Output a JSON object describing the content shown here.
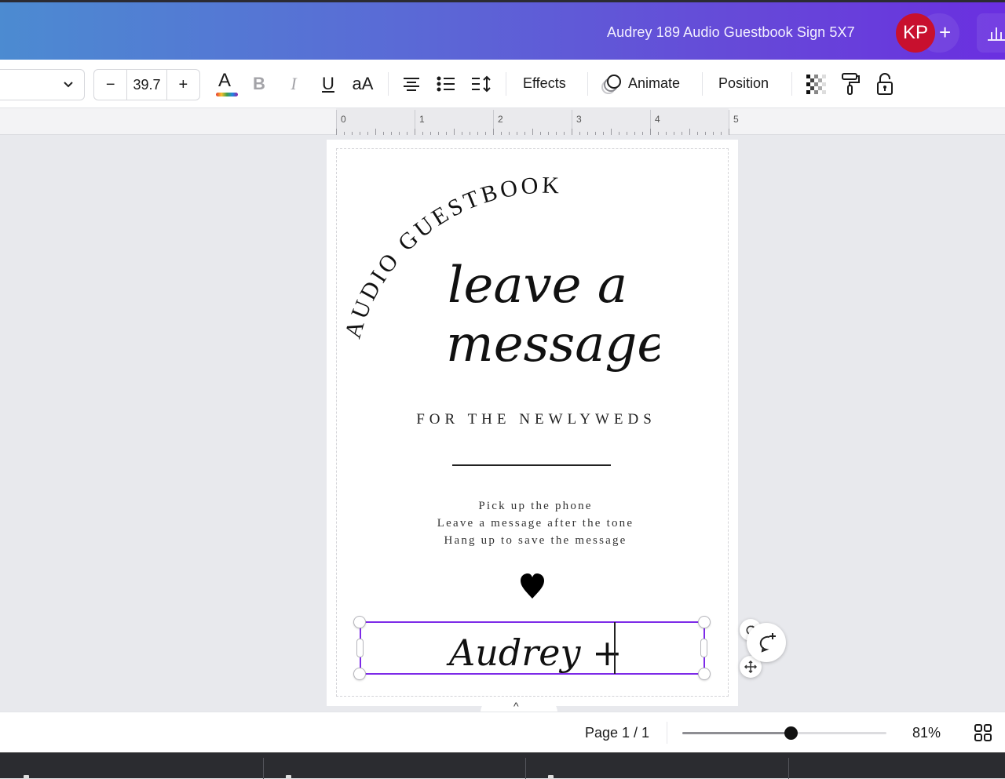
{
  "header": {
    "document_title": "Audrey 189 Audio Guestbook Sign 5X7",
    "avatar_initials": "KP",
    "add_label": "+",
    "insights_icon": "bar-chart-icon",
    "brand_gradient": [
      "#4c8bd1",
      "#6a2fe0"
    ],
    "avatar_color": "#c8102e"
  },
  "toolbar": {
    "font_family_value": "",
    "font_size": {
      "decrease_label": "−",
      "value": "39.7",
      "increase_label": "+"
    },
    "icons": [
      "text-color-icon",
      "bold-icon",
      "italic-icon",
      "underline-icon",
      "letter-case-icon",
      "align-center-icon",
      "bullet-list-icon",
      "spacing-icon"
    ],
    "text_color_glyph": "A",
    "bold_glyph": "B",
    "italic_glyph": "I",
    "underline_glyph": "U",
    "case_glyph": "aA",
    "effects_label": "Effects",
    "animate_label": "Animate",
    "position_label": "Position",
    "right_icons": [
      "transparency-icon",
      "paint-roller-icon",
      "unlock-icon"
    ]
  },
  "ruler": {
    "labels": [
      "0",
      "1",
      "2",
      "3",
      "4",
      "5"
    ]
  },
  "design": {
    "arc_text": "AUDIO GUESTBOOK",
    "headline_line1": "leave a",
    "headline_line2": "message",
    "subtitle": "FOR THE NEWLYWEDS",
    "instructions": [
      "Pick up the phone",
      "Leave a message after the tone",
      "Hang up to save the message"
    ],
    "heart_icon": "heart-icon",
    "names_text": "Audrey + J",
    "selection_color": "#7d2ae8"
  },
  "floating_controls": {
    "rotate_icon": "rotate-icon",
    "comment_icon": "add-comment-icon",
    "move_icon": "move-icon"
  },
  "collapse_label": "^",
  "footer": {
    "page_indicator": "Page 1 / 1",
    "zoom_percent": "81%",
    "zoom_slider_fraction": 0.53,
    "grid_view_icon": "grid-view-icon"
  }
}
